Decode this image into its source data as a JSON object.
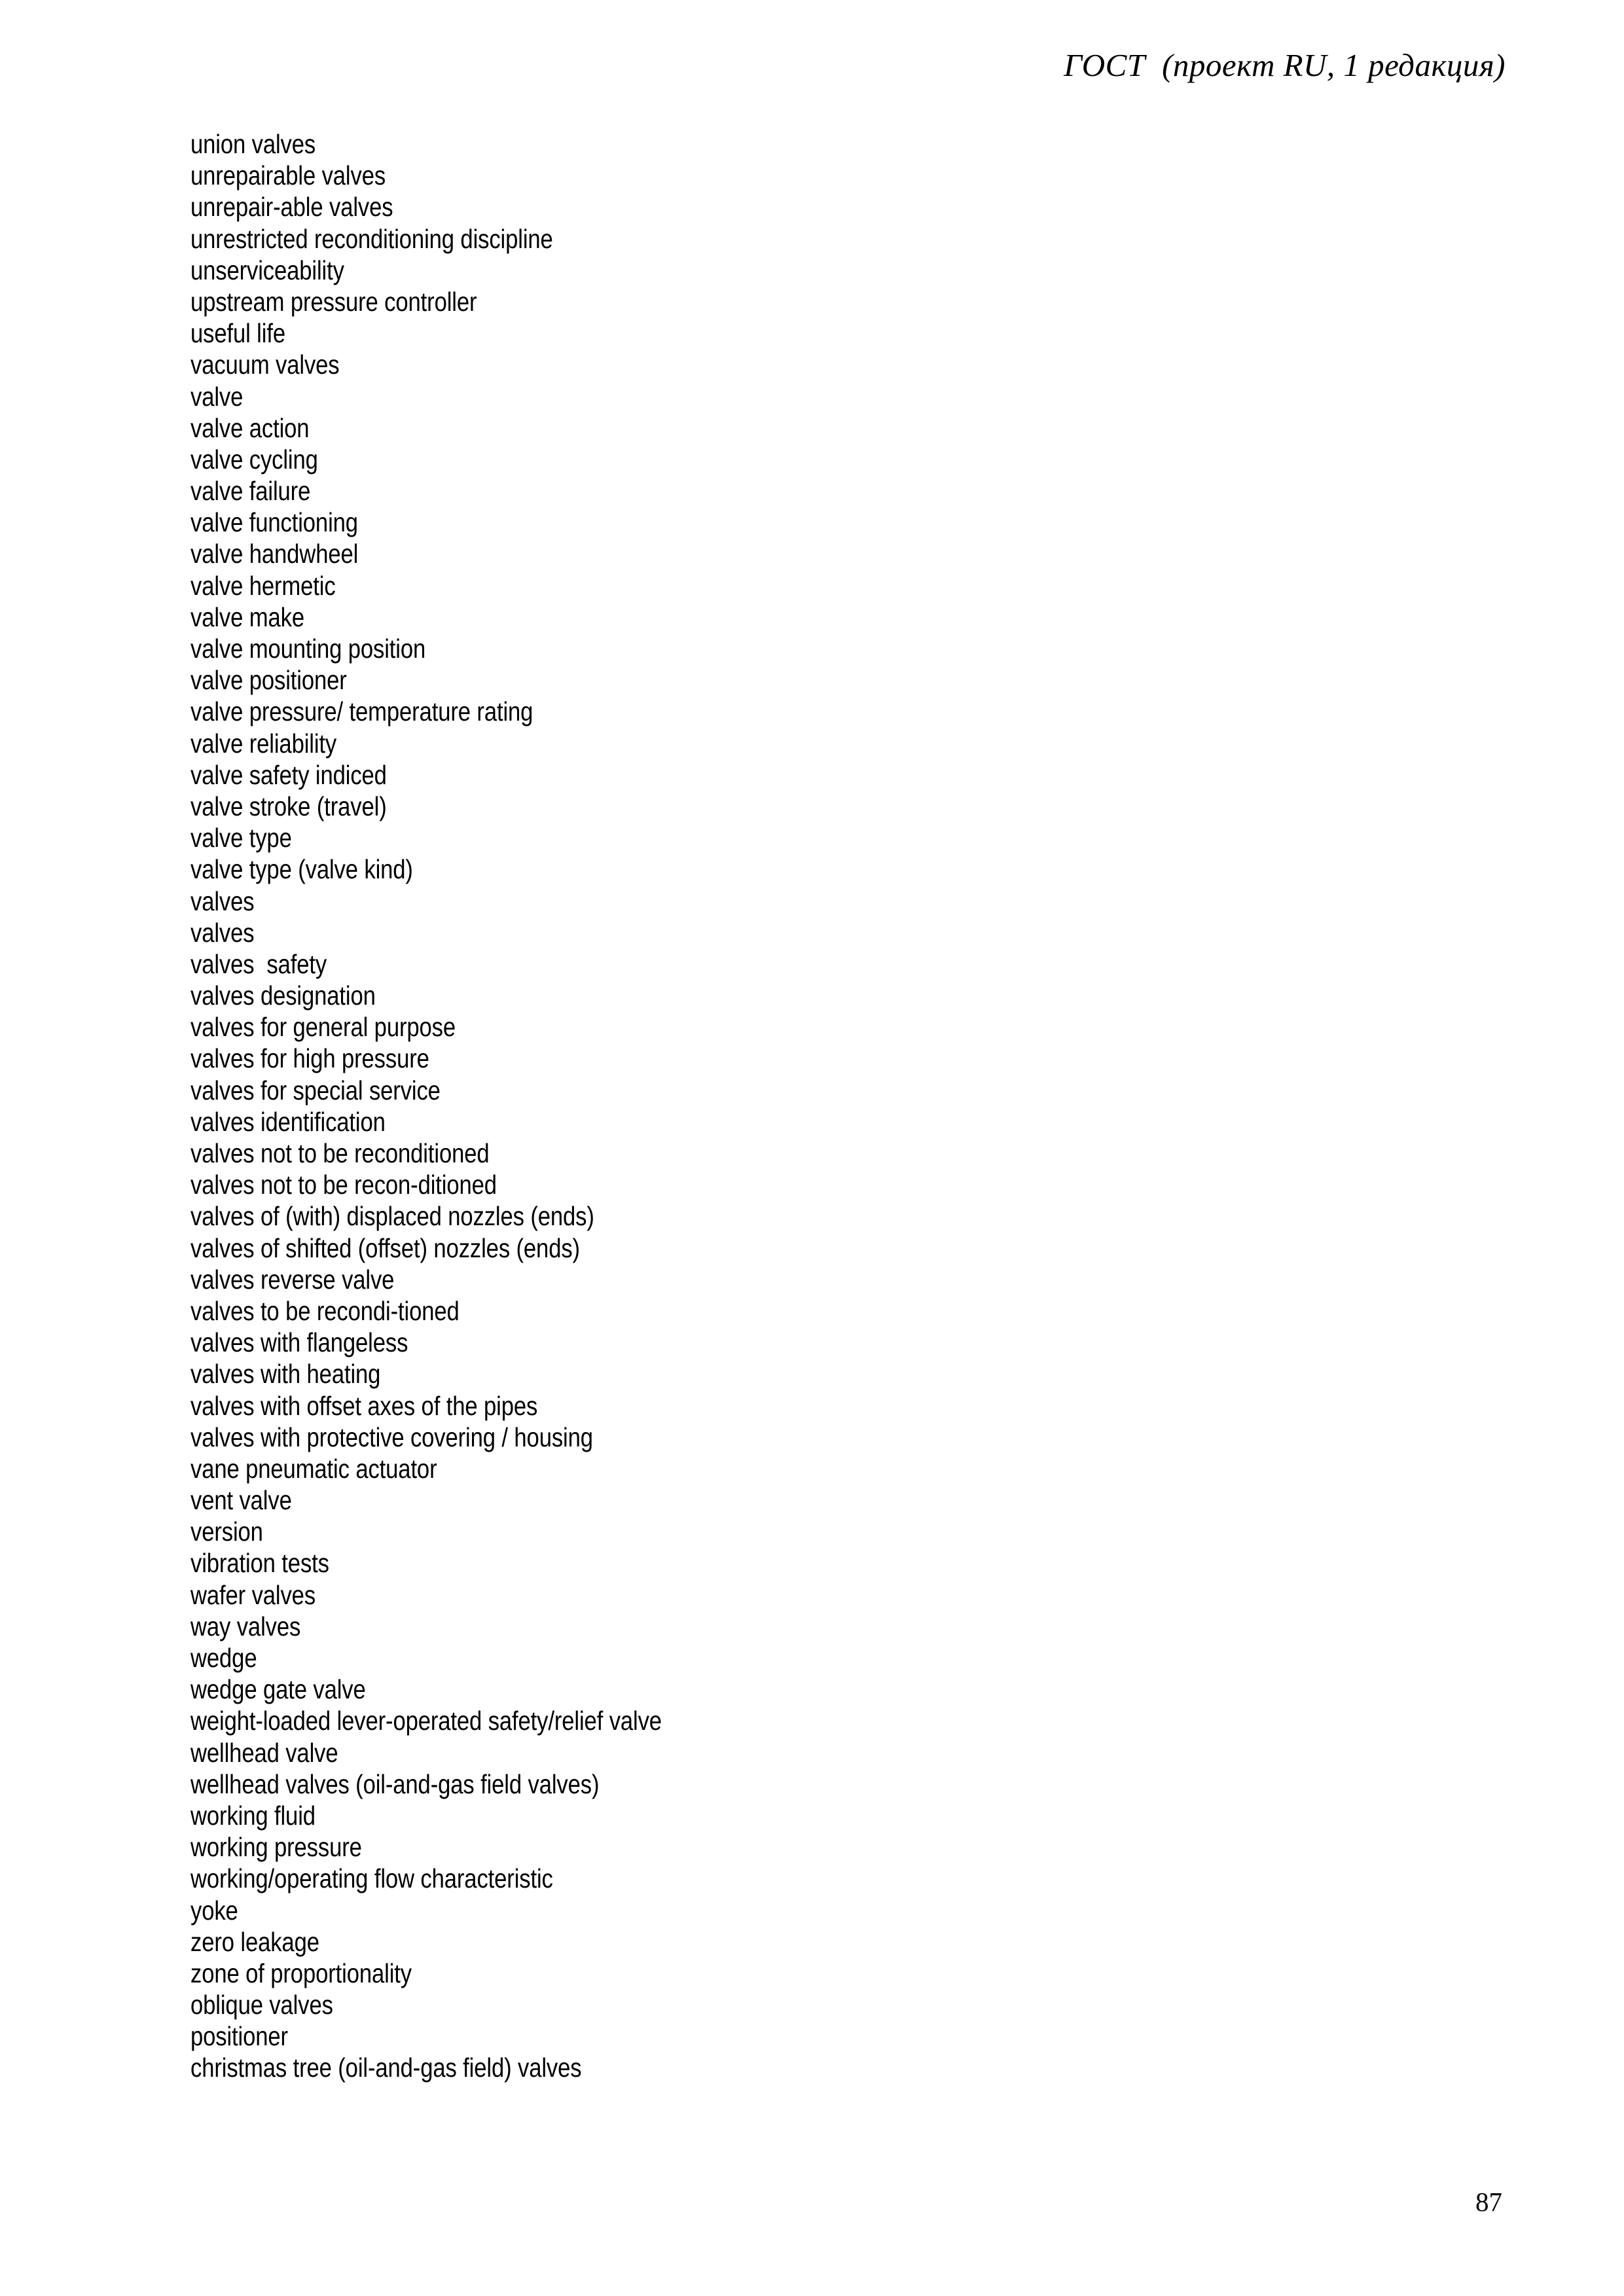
{
  "document": {
    "header_text": "ГОСТ  (проект RU, 1 редакция)",
    "page_number": "87"
  },
  "glossary": {
    "terms": [
      "union valves",
      "unrepairable valves",
      "unrepair-able valves",
      "unrestricted reconditioning discipline",
      "unserviceability",
      "upstream pressure controller",
      "useful life",
      "vacuum valves",
      "valve",
      "valve action",
      "valve cycling",
      "valve failure",
      "valve functioning",
      "valve handwheel",
      "valve hermetic",
      "valve make",
      "valve mounting position",
      "valve positioner",
      "valve pressure/ temperature rating",
      "valve reliability",
      "valve safety indiced",
      "valve stroke (travel)",
      "valve type",
      "valve type (valve kind)",
      "valves",
      "valves",
      "valves  safety",
      "valves designation",
      "valves for general purpose",
      "valves for high pressure",
      "valves for special service",
      "valves identification",
      "valves not to be reconditioned",
      "valves not to be recon-ditioned",
      "valves of (with) displaced nozzles (ends)",
      "valves of shifted (offset) nozzles (ends)",
      "valves reverse valve",
      "valves to be recondi-tioned",
      "valves with flangeless",
      "valves with heating",
      "valves with offset axes of the pipes",
      "valves with protective covering / housing",
      "vane pneumatic actuator",
      "vent valve",
      "version",
      "vibration tests",
      "wafer valves",
      "way valves",
      "wedge",
      "wedge gate valve",
      "weight-loaded lever-operated safety/relief valve",
      "wellhead valve",
      "wellhead valves (oil-and-gas field valves)",
      "working fluid",
      "working pressure",
      "working/operating flow characteristic",
      "yoke",
      "zero leakage",
      "zone of proportionality",
      "oblique valves",
      "positioner",
      "christmas tree (oil-and-gas field) valves"
    ]
  }
}
